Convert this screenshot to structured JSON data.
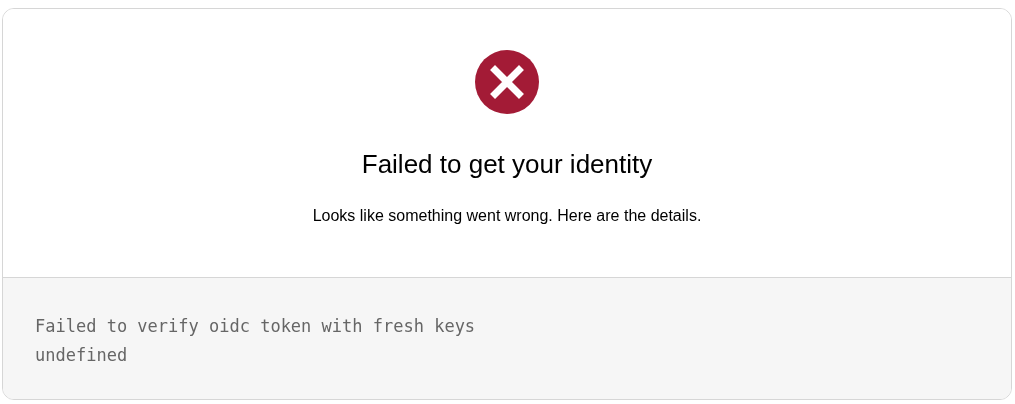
{
  "status": {
    "kind": "error"
  },
  "title": "Failed to get your identity",
  "subtitle": "Looks like something went wrong. Here are the details.",
  "details": [
    "Failed to verify oidc token with fresh keys",
    "undefined"
  ]
}
